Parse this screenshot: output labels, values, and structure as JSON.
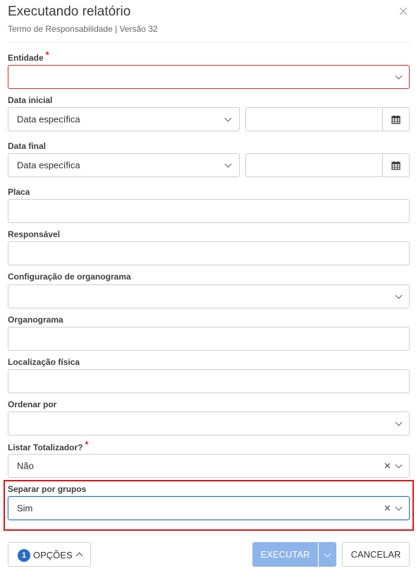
{
  "header": {
    "title": "Executando relatório",
    "subtitle": "Termo de Responsabilidade | Versão 32"
  },
  "icons": {
    "close": "close-icon",
    "chevron": "chevron-down-icon",
    "calendar": "calendar-icon",
    "clear": "clear-icon"
  },
  "fields": {
    "entidade": {
      "label": "Entidade",
      "required_mark": "*",
      "value": ""
    },
    "data_inicial": {
      "label": "Data inicial",
      "select_value": "Data específica",
      "date_value": ""
    },
    "data_final": {
      "label": "Data final",
      "select_value": "Data específica",
      "date_value": ""
    },
    "placa": {
      "label": "Placa",
      "value": ""
    },
    "responsavel": {
      "label": "Responsável",
      "value": ""
    },
    "config_organograma": {
      "label": "Configuração de organograma",
      "value": ""
    },
    "organograma": {
      "label": "Organograma",
      "value": ""
    },
    "localizacao_fisica": {
      "label": "Localização física",
      "value": ""
    },
    "ordenar_por": {
      "label": "Ordenar por",
      "value": ""
    },
    "listar_totalizador": {
      "label": "Listar Totalizador?",
      "required_mark": "*",
      "value": "Não"
    },
    "separar_por_grupos": {
      "label": "Separar por grupos",
      "value": "Sim"
    }
  },
  "footer": {
    "options_count": "1",
    "options_label": "OPÇÕES",
    "execute_label": "EXECUTAR",
    "cancel_label": "CANCELAR"
  },
  "colors": {
    "primary": "#2a6dc2",
    "primary_disabled": "#8fb4ea",
    "required": "#d9282f",
    "highlight": "#e01414"
  }
}
